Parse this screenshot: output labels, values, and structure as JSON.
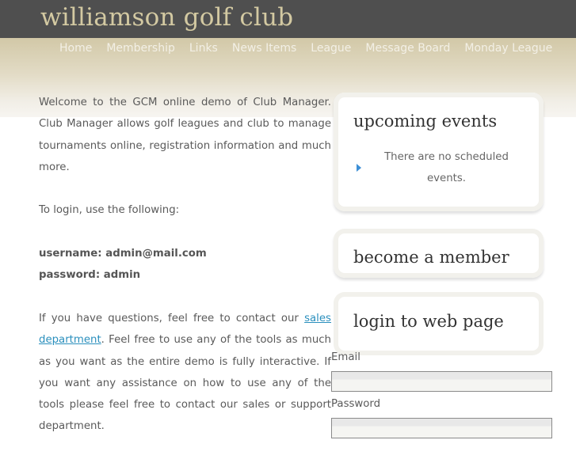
{
  "header": {
    "site_title": "williamson golf club"
  },
  "nav": {
    "items": [
      {
        "label": "Home"
      },
      {
        "label": "Membership"
      },
      {
        "label": "Links"
      },
      {
        "label": "News Items"
      },
      {
        "label": "League"
      },
      {
        "label": "Message Board"
      },
      {
        "label": "Monday League"
      }
    ]
  },
  "main": {
    "intro": "Welcome to the GCM online demo of Club Manager. Club Manager allows golf leagues and club to manage tournaments online, registration information and much more.",
    "login_hint": "To login, use the following:",
    "username_line": "username: admin@mail.com",
    "password_line": "password: admin",
    "contact_before": "If you have questions, feel free to contact our ",
    "contact_link": "sales department",
    "contact_after": ".  Feel free to use any of the tools as much as you want as the entire demo is fully interactive.  If you want any assistance on how to use any of the tools please feel free to contact our sales or support department."
  },
  "sidebar": {
    "events_title": "upcoming events",
    "events_empty": "There are no scheduled events.",
    "member_title": "become a member",
    "login_title": "login to web page",
    "email_label": "Email",
    "email_value": "",
    "password_label": "Password",
    "password_value": ""
  },
  "colors": {
    "topbar": "#4f4f4f",
    "title": "#d3c9a2",
    "link": "#2a8fbd",
    "bullet": "#3d8fd6"
  }
}
